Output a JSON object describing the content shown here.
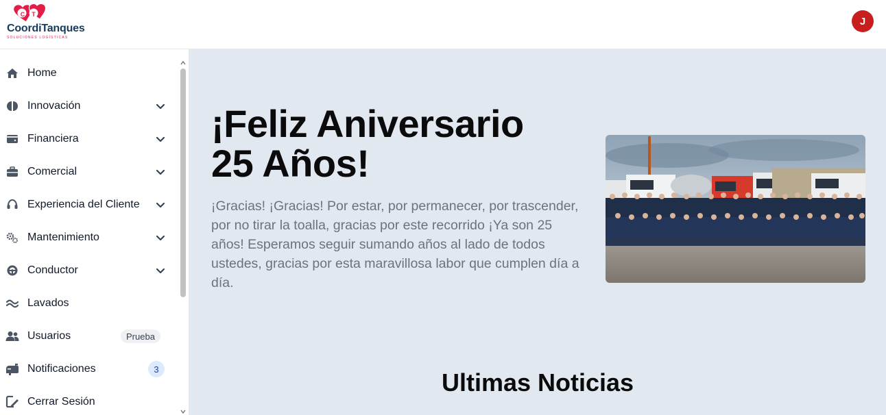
{
  "brand": {
    "initials": "CT",
    "name": "CoordiTanques",
    "tagline": "Soluciones Logísticas",
    "colors": {
      "primary": "#163a5a",
      "accent": "#e11d48"
    }
  },
  "user": {
    "avatar_initial": "J",
    "avatar_color": "#c81e1e"
  },
  "sidebar": {
    "items": [
      {
        "label": "Home",
        "icon": "home-icon",
        "expandable": false
      },
      {
        "label": "Innovación",
        "icon": "brain-icon",
        "expandable": true
      },
      {
        "label": "Financiera",
        "icon": "wallet-icon",
        "expandable": true
      },
      {
        "label": "Comercial",
        "icon": "briefcase-icon",
        "expandable": true
      },
      {
        "label": "Experiencia del Cliente",
        "icon": "headset-icon",
        "expandable": true
      },
      {
        "label": "Mantenimiento",
        "icon": "gears-icon",
        "expandable": true
      },
      {
        "label": "Conductor",
        "icon": "steering-wheel-icon",
        "expandable": true
      },
      {
        "label": "Lavados",
        "icon": "water-icon",
        "expandable": false
      },
      {
        "label": "Usuarios",
        "icon": "users-icon",
        "expandable": false,
        "badge": "Prueba"
      },
      {
        "label": "Notificaciones",
        "icon": "mailbox-icon",
        "expandable": false,
        "count": "3"
      },
      {
        "label": "Cerrar Sesión",
        "icon": "sign-out-icon",
        "expandable": false
      }
    ]
  },
  "hero": {
    "title_line1": "¡Feliz Aniversario",
    "title_line2": "25 Años!",
    "text": "¡Gracias! ¡Gracias! Por estar, por permanecer, por trascender, por no tirar la toalla, gracias por este recorrido ¡Ya son 25 años! Esperamos seguir sumando años al lado de todos ustedes, gracias por esta maravillosa labor que cumplen día a día.",
    "photo": "team-with-tanker-trucks-photo"
  },
  "news": {
    "title": "Ultimas Noticias"
  }
}
